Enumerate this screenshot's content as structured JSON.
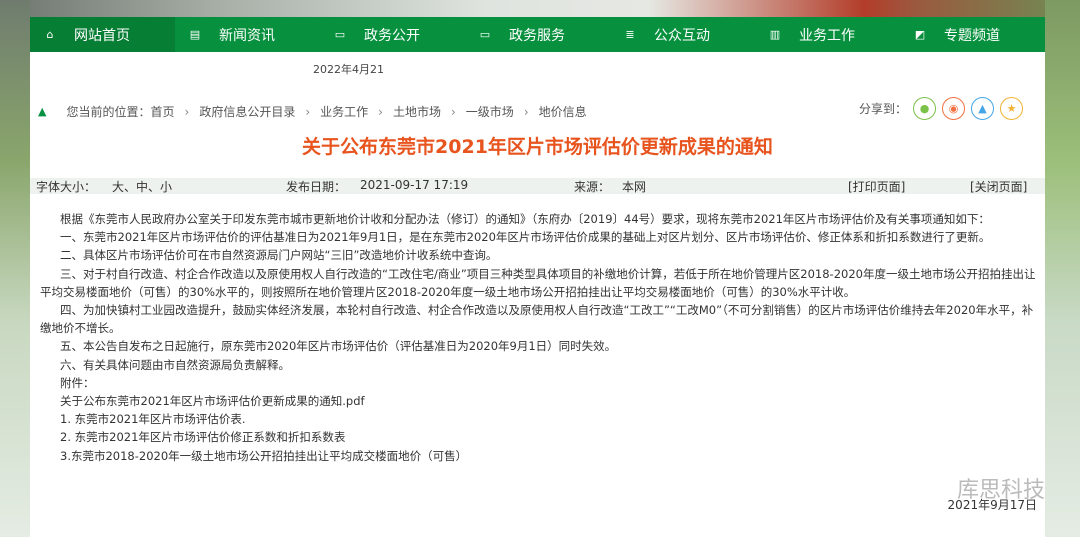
{
  "nav": [
    {
      "label": "网站首页",
      "icon": "home-icon",
      "glyph": "⌂"
    },
    {
      "label": "新闻资讯",
      "icon": "calendar-icon",
      "glyph": "▤"
    },
    {
      "label": "政务公开",
      "icon": "folder-icon",
      "glyph": "▭"
    },
    {
      "label": "政务服务",
      "icon": "laptop-icon",
      "glyph": "▭"
    },
    {
      "label": "公众互动",
      "icon": "list-icon",
      "glyph": "≣"
    },
    {
      "label": "业务工作",
      "icon": "building-icon",
      "glyph": "▥"
    },
    {
      "label": "专题频道",
      "icon": "image-icon",
      "glyph": "◩"
    }
  ],
  "top_date": "2022年4月21",
  "breadcrumb": {
    "prefix": "您当前的位置：",
    "items": [
      "首页",
      "政府信息公开目录",
      "业务工作",
      "土地市场",
      "一级市场",
      "地价信息"
    ]
  },
  "share": {
    "label": "分享到：",
    "items": [
      {
        "name": "wechat",
        "glyph": "●",
        "color": "#7cc24a"
      },
      {
        "name": "weibo",
        "glyph": "◉",
        "color": "#f0703f"
      },
      {
        "name": "qq",
        "glyph": "▲",
        "color": "#43a5e6"
      },
      {
        "name": "favorite",
        "glyph": "★",
        "color": "#f2b233"
      }
    ]
  },
  "article": {
    "title": "关于公布东莞市2021年区片市场评估价更新成果的通知",
    "font_size_label": "字体大小：",
    "font_sizes": "大、中、小",
    "date_label": "发布日期：",
    "date": "2021-09-17 17:19",
    "source_label": "来源：",
    "source": "本网",
    "print": "[打印页面]",
    "close": "[关闭页面]",
    "paragraphs": [
      "根据《东莞市人民政府办公室关于印发东莞市城市更新地价计收和分配办法（修订）的通知》（东府办〔2019〕44号）要求，现将东莞市2021年区片市场评估价及有关事项通知如下：",
      "一、东莞市2021年区片市场评估价的评估基准日为2021年9月1日，是在东莞市2020年区片市场评估价成果的基础上对区片划分、区片市场评估价、修正体系和折扣系数进行了更新。",
      "二、具体区片市场评估价可在市自然资源局门户网站“三旧”改造地价计收系统中查询。",
      "三、对于村自行改造、村企合作改造以及原使用权人自行改造的“工改住宅/商业”项目三种类型具体项目的补缴地价计算，若低于所在地价管理片区2018-2020年度一级土地市场公开招拍挂出让平均交易楼面地价（可售）的30%水平的，则按照所在地价管理片区2018-2020年度一级土地市场公开招拍挂出让平均交易楼面地价（可售）的30%水平计收。",
      "四、为加快镇村工业园改造提升，鼓励实体经济发展，本轮村自行改造、村企合作改造以及原使用权人自行改造“工改工”“工改M0”（不可分割销售）的区片市场评估价维持去年2020年水平，补缴地价不增长。",
      "五、本公告自发布之日起施行，原东莞市2020年区片市场评估价（评估基准日为2020年9月1日）同时失效。",
      "六、有关具体问题由市自然资源局负责解释。",
      "附件："
    ],
    "attachments": [
      "关于公布东莞市2021年区片市场评估价更新成果的通知.pdf",
      "1. 东莞市2021年区片市场评估价表.",
      "2. 东莞市2021年区片市场评估价修正系数和折扣系数表",
      "3.东莞市2018-2020年一级土地市场公开招拍挂出让平均成交楼面地价（可售）"
    ]
  },
  "watermark": {
    "text": "库思科技",
    "date": "2021年9月17日"
  }
}
